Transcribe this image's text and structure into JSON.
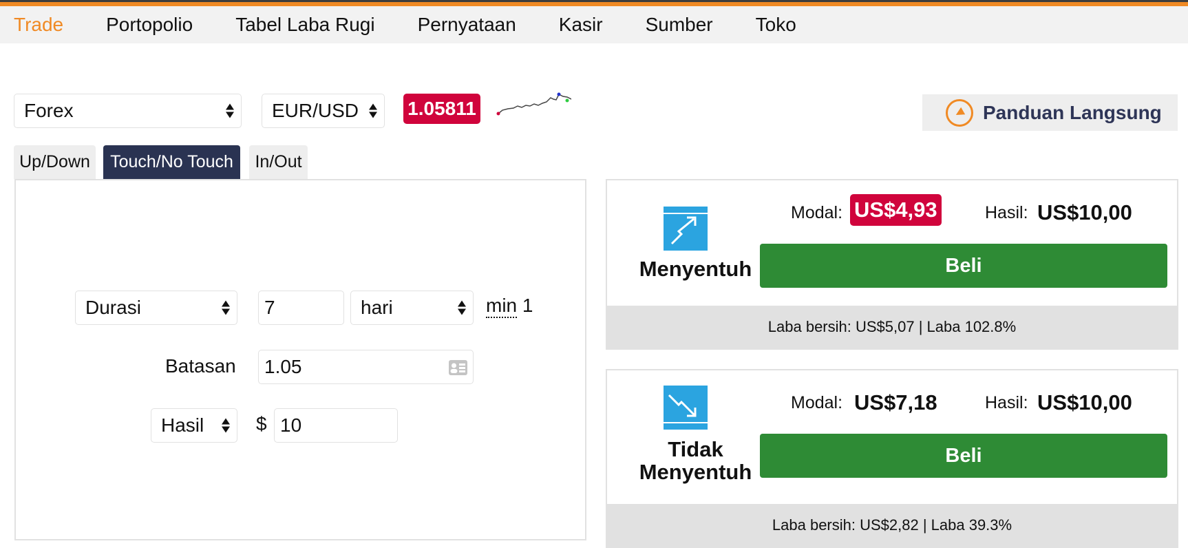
{
  "nav": {
    "items": [
      {
        "label": "Trade",
        "active": true
      },
      {
        "label": "Portopolio",
        "active": false
      },
      {
        "label": "Tabel Laba Rugi",
        "active": false
      },
      {
        "label": "Pernyataan",
        "active": false
      },
      {
        "label": "Kasir",
        "active": false
      },
      {
        "label": "Sumber",
        "active": false
      },
      {
        "label": "Toko",
        "active": false
      }
    ]
  },
  "market": {
    "category": "Forex",
    "symbol": "EUR/USD",
    "price": "1.05811",
    "sparkline_icon": "price-sparkline"
  },
  "guide": {
    "label": "Panduan Langsung",
    "icon": "navigation-arrow-icon"
  },
  "tabs": [
    {
      "label": "Up/Down",
      "active": false
    },
    {
      "label": "Touch/No Touch",
      "active": true
    },
    {
      "label": "In/Out",
      "active": false
    }
  ],
  "form": {
    "duration_type": "Durasi",
    "duration_value": "7",
    "duration_unit": "hari",
    "min_label": "min",
    "min_value": "1",
    "barrier_label": "Batasan",
    "barrier_value": "1.05",
    "payout_type": "Hasil",
    "currency_symbol": "$",
    "payout_value": "10"
  },
  "contracts": [
    {
      "title": "Menyentuh",
      "stake_label": "Modal:",
      "stake_value": "US$4,93",
      "payout_label": "Hasil:",
      "payout_value": "US$10,00",
      "buy_label": "Beli",
      "footer": "Laba bersih: US$5,07 | Laba 102.8%"
    },
    {
      "title_line1": "Tidak",
      "title_line2": "Menyentuh",
      "stake_label": "Modal:",
      "stake_value": "US$7,18",
      "payout_label": "Hasil:",
      "payout_value": "US$10,00",
      "buy_label": "Beli",
      "footer": "Laba bersih: US$2,82 | Laba 39.3%"
    }
  ],
  "colors": {
    "accent_orange": "#f08a24",
    "price_red": "#d0043c",
    "tab_active": "#2a3352",
    "buy_green": "#2e8b35",
    "icon_blue": "#2ba4e0"
  }
}
